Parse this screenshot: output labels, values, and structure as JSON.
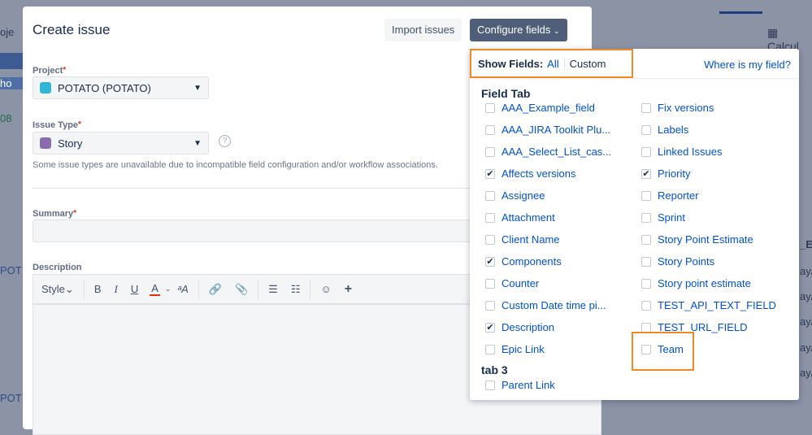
{
  "background": {
    "left_fragments": [
      "oje",
      "ho",
      "08",
      "POT",
      "POT"
    ],
    "calc_label": "Calcul",
    "col_head": "_E",
    "rows": [
      "ay/",
      "ay/",
      "ay/",
      "ay/",
      "ay/"
    ]
  },
  "modal": {
    "title": "Create issue",
    "import_label": "Import issues",
    "configure_label": "Configure fields",
    "project": {
      "label": "Project",
      "value": "POTATO (POTATO)"
    },
    "issue_type": {
      "label": "Issue Type",
      "value": "Story",
      "note": "Some issue types are unavailable due to incompatible field configuration and/or workflow associations."
    },
    "summary": {
      "label": "Summary",
      "value": ""
    },
    "description": {
      "label": "Description",
      "toolbar": {
        "style": "Style",
        "bold": "B",
        "italic": "I",
        "underline": "U",
        "color": "A",
        "text_size": "ᵃA",
        "link": "🔗",
        "attach": "📎",
        "bullets": "☰",
        "numbers": "☷",
        "emoji": "☺",
        "plus": "+"
      }
    }
  },
  "colors": {
    "accent": "#0052cc",
    "highlight": "#f08a24",
    "dark_button": "#505f79"
  },
  "fields_panel": {
    "show_fields_label": "Show Fields:",
    "all": "All",
    "custom": "Custom",
    "where_link": "Where is my field?",
    "tab1": "Field Tab",
    "left": [
      {
        "label": "AAA_Example_field",
        "checked": false
      },
      {
        "label": "AAA_JIRA Toolkit Plu...",
        "checked": false
      },
      {
        "label": "AAA_Select_List_cas...",
        "checked": false
      },
      {
        "label": "Affects versions",
        "checked": true
      },
      {
        "label": "Assignee",
        "checked": false
      },
      {
        "label": "Attachment",
        "checked": false
      },
      {
        "label": "Client Name",
        "checked": false
      },
      {
        "label": "Components",
        "checked": true
      },
      {
        "label": "Counter",
        "checked": false
      },
      {
        "label": "Custom Date time pi...",
        "checked": false
      },
      {
        "label": "Description",
        "checked": true
      },
      {
        "label": "Epic Link",
        "checked": false
      }
    ],
    "right": [
      {
        "label": "Fix versions",
        "checked": false
      },
      {
        "label": "Labels",
        "checked": false
      },
      {
        "label": "Linked Issues",
        "checked": false
      },
      {
        "label": "Priority",
        "checked": true
      },
      {
        "label": "Reporter",
        "checked": false
      },
      {
        "label": "Sprint",
        "checked": false
      },
      {
        "label": "Story Point Estimate",
        "checked": false
      },
      {
        "label": "Story Points",
        "checked": false
      },
      {
        "label": "Story point estimate",
        "checked": false
      },
      {
        "label": "TEST_API_TEXT_FIELD",
        "checked": false
      },
      {
        "label": "TEST_URL_FIELD",
        "checked": false
      },
      {
        "label": "Team",
        "checked": false
      }
    ],
    "tab2": "tab 3",
    "tab2_items": [
      {
        "label": "Parent Link",
        "checked": false
      }
    ]
  }
}
